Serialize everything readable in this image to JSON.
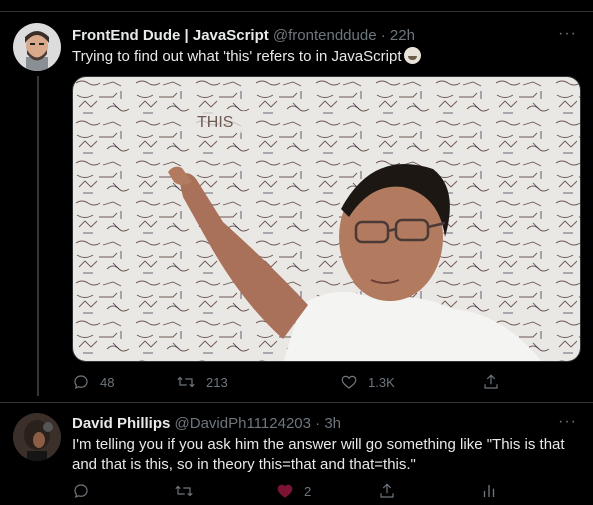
{
  "tweets": [
    {
      "author_name": "FrontEnd Dude | JavaScript",
      "author_handle": "@frontenddude",
      "separator": "·",
      "time": "22h",
      "text": "Trying to find out what 'this' refers to in JavaScript",
      "emoji": "grinning-sweat-emoji",
      "media_handwriting": "THIS",
      "replies": "48",
      "retweets": "213",
      "likes": "1.3K"
    },
    {
      "author_name": "David Phillips",
      "author_handle": "@DavidPh11124203",
      "separator": "·",
      "time": "3h",
      "text": "I'm telling you if you ask him the answer will go something like \"This is that and that is this, so in theory this=that and that=this.\"",
      "replies": "",
      "retweets": "",
      "likes": "2"
    }
  ],
  "more_label": "···",
  "colors": {
    "background": "#000000",
    "muted": "#6e767d",
    "text": "#e7e9ea",
    "divider": "#2f3336"
  },
  "icons": [
    "reply-icon",
    "retweet-icon",
    "like-icon",
    "share-icon",
    "analytics-icon",
    "more-icon"
  ]
}
